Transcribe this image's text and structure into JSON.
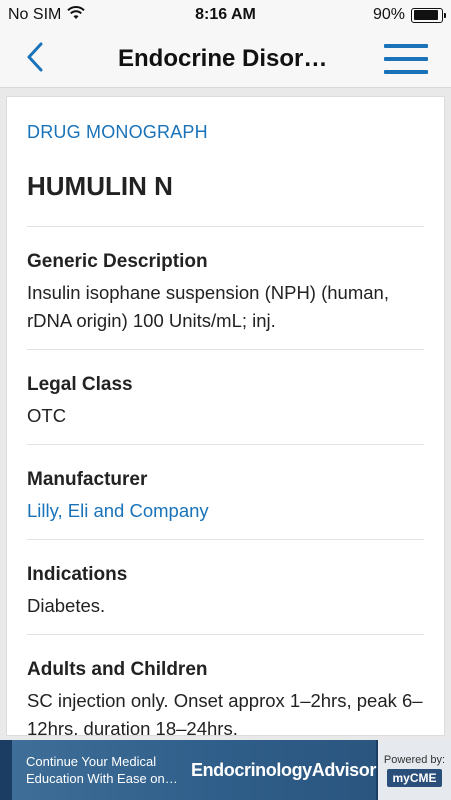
{
  "status_bar": {
    "carrier": "No SIM",
    "time": "8:16 AM",
    "battery_text": "90%",
    "battery_level": 0.9,
    "wifi_icon": "wifi-icon"
  },
  "nav": {
    "title": "Endocrine Disor…",
    "back_icon": "chevron-left-icon",
    "menu_icon": "hamburger-menu-icon",
    "accent_color": "#1a73b9"
  },
  "monograph": {
    "section_label": "DRUG MONOGRAPH",
    "drug_name": "HUMULIN N",
    "fields": [
      {
        "label": "Generic Description",
        "value": "Insulin isophane suspension (NPH) (human, rDNA origin) 100 Units/mL; inj."
      },
      {
        "label": "Legal Class",
        "value": "OTC"
      },
      {
        "label": "Manufacturer",
        "value": "Lilly, Eli and Company"
      },
      {
        "label": "Indications",
        "value": "Diabetes."
      },
      {
        "label": "Adults and Children",
        "value": "SC injection only. Onset approx 1–2hrs, peak 6–12hrs, duration 18–24hrs."
      }
    ]
  },
  "ad": {
    "tagline": "Continue Your Medical Education With Ease on…",
    "brand": "EndocrinologyAdvisor",
    "powered_by": "Powered by:",
    "cme_badge": "myCME"
  }
}
